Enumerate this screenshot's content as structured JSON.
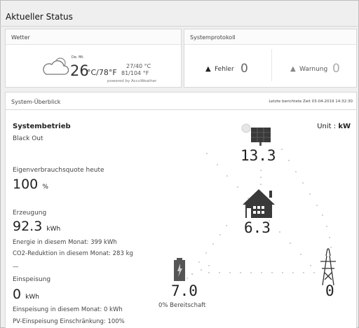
{
  "page": {
    "title": "Aktueller Status"
  },
  "weather": {
    "header": "Wetter",
    "location_short": "De. Mt.",
    "temp_main": "26",
    "temp_unit": "°C/78°F",
    "range_c": "27/40 °C",
    "range_f": "81/104 °F",
    "powered_by": "powered by AccuWeather",
    "icon": "partly-cloudy-icon"
  },
  "system_log": {
    "header": "Systemprotokoll",
    "error_label": "Fehler",
    "error_count": "0",
    "warning_label": "Warnung",
    "warning_count": "0",
    "error_icon": "warning-triangle-icon",
    "warning_icon": "warning-triangle-icon"
  },
  "overview": {
    "header": "System-Überblick",
    "last_report": "Letzte berichtete Zeit 03-04-2019 14:32:30",
    "unit_label": "Unit :",
    "unit_value": "kW",
    "system_mode_title": "Systembetrieb",
    "system_mode_value": "Black Out",
    "self_consumption_label": "Eigenverbrauchsquote heute",
    "self_consumption_value": "100",
    "self_consumption_unit": "%",
    "generation_label": "Erzeugung",
    "generation_value": "92.3",
    "generation_unit": "kWh",
    "energy_month": "Energie in diesem Monat: 399 kWh",
    "co2_month": "CO2-Reduktion in diesem Monat: 283 kg",
    "dash": "—",
    "feed_in_label": "Einspeisung",
    "feed_in_value": "0",
    "feed_in_unit": "kWh",
    "feed_in_month": "Einspeisung in diesem Monat: 0 kWh",
    "pv_limit": "PV-Einspeisung Einschränkung: 100%",
    "pv_power": "13.3",
    "home_power": "6.3",
    "battery_power": "7.0",
    "battery_state": "0% Bereitschaft",
    "grid_power": "0"
  },
  "colors": {
    "panel_dark": "#3a3a3a",
    "house_dark": "#3a3a3a",
    "battery_dark": "#555555",
    "flow_dots": "#bdbdbd"
  }
}
